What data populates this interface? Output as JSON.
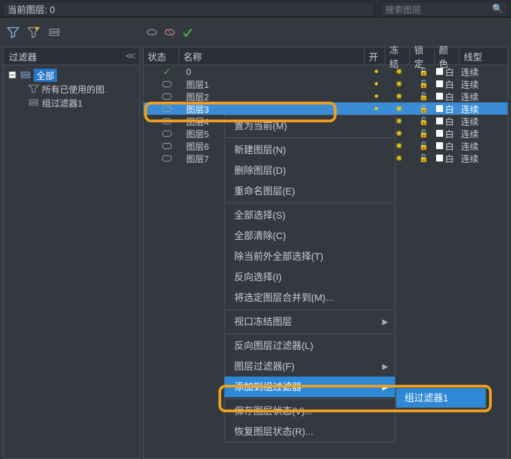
{
  "header": {
    "current_layer_label": "当前图层:  0",
    "search_placeholder": "搜索图层"
  },
  "filters_panel": {
    "title": "过滤器",
    "root": "全部",
    "children": [
      "所有已使用的图.",
      "组过滤器1"
    ]
  },
  "columns": {
    "status": "状态",
    "name": "名称",
    "on": "开",
    "freeze": "冻结",
    "lock": "锁定",
    "color": "颜色",
    "linetype": "线型"
  },
  "layers": [
    {
      "name": "0",
      "current": true,
      "selected": false,
      "color_label": "白",
      "linetype": "连续"
    },
    {
      "name": "图层1",
      "current": false,
      "selected": false,
      "color_label": "白",
      "linetype": "连续"
    },
    {
      "name": "图层2",
      "current": false,
      "selected": false,
      "color_label": "白",
      "linetype": "连续"
    },
    {
      "name": "图层3",
      "current": false,
      "selected": true,
      "color_label": "白",
      "linetype": "连续"
    },
    {
      "name": "图层4",
      "current": false,
      "selected": false,
      "color_label": "白",
      "linetype": "连续"
    },
    {
      "name": "图层5",
      "current": false,
      "selected": false,
      "color_label": "白",
      "linetype": "连续"
    },
    {
      "name": "图层6",
      "current": false,
      "selected": false,
      "color_label": "白",
      "linetype": "连续"
    },
    {
      "name": "图层7",
      "current": false,
      "selected": false,
      "color_label": "白",
      "linetype": "连续"
    }
  ],
  "context_menu": {
    "set_current": "置为当前(M)",
    "new_layer": "新建图层(N)",
    "delete_layer": "删除图层(D)",
    "rename_layer": "重命名图层(E)",
    "select_all": "全部选择(S)",
    "clear_all": "全部清除(C)",
    "select_all_but": "除当前外全部选择(T)",
    "invert_sel": "反向选择(I)",
    "merge_to": "将选定图层合并到(M)...",
    "vp_freeze": "视口冻结图层",
    "invert_filter": "反向图层过滤器(L)",
    "layer_filter": "图层过滤器(F)",
    "add_to_group": "添加到组过滤器",
    "save_state": "保存图层状态(V)...",
    "restore_state": "恢复图层状态(R)..."
  },
  "submenu": {
    "item": "组过滤器1"
  }
}
